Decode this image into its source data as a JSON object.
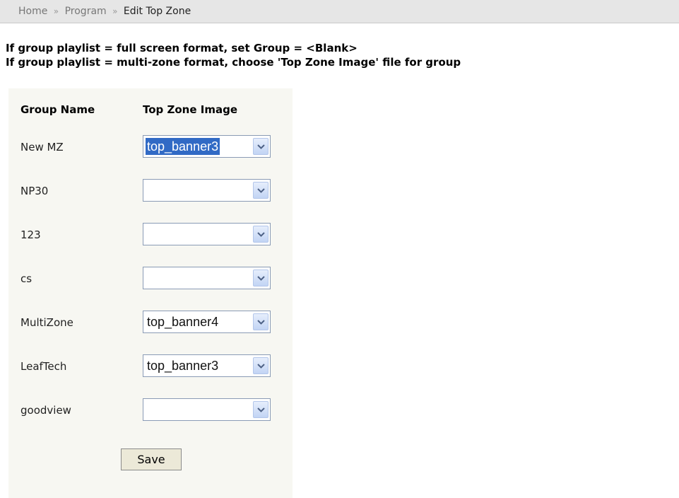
{
  "breadcrumb": {
    "home": "Home",
    "separator": "»",
    "program": "Program",
    "current": "Edit Top Zone"
  },
  "instructions": {
    "line1": "If group playlist = full screen format, set Group = <Blank>",
    "line2": "If group playlist = multi-zone format, choose 'Top Zone Image' file for group"
  },
  "table": {
    "headers": {
      "group_name": "Group Name",
      "top_zone_image": "Top Zone Image"
    },
    "rows": [
      {
        "group_name": "New MZ",
        "image": "top_banner3",
        "focused": true
      },
      {
        "group_name": "NP30",
        "image": "",
        "focused": false
      },
      {
        "group_name": "123",
        "image": "",
        "focused": false
      },
      {
        "group_name": "cs",
        "image": "",
        "focused": false
      },
      {
        "group_name": "MultiZone",
        "image": "top_banner4",
        "focused": false
      },
      {
        "group_name": "LeafTech",
        "image": "top_banner3",
        "focused": false
      },
      {
        "group_name": "goodview",
        "image": "",
        "focused": false
      }
    ]
  },
  "save_label": "Save",
  "colors": {
    "breadcrumb_bg": "#e6e6e6",
    "panel_bg": "#f7f7f2",
    "selection_highlight": "#316ac5"
  },
  "icons": {
    "dropdown": "chevron-down-icon"
  }
}
